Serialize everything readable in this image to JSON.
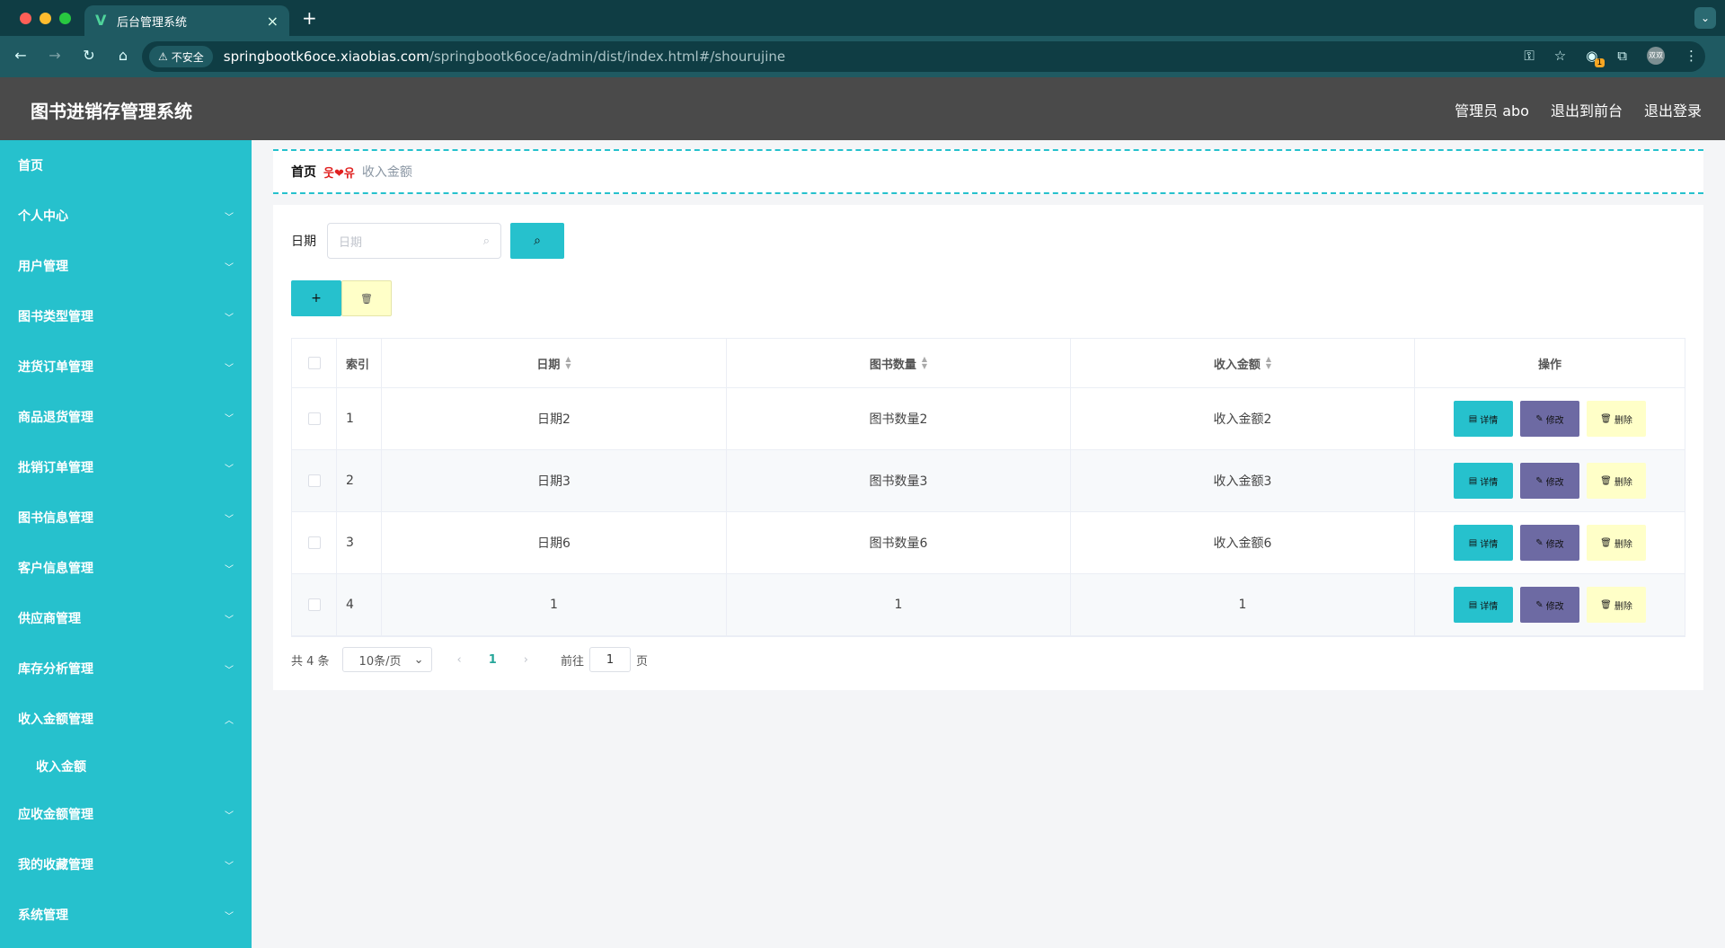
{
  "browser": {
    "tab_title": "后台管理系统",
    "insecure_label": "不安全",
    "url_host": "springbootk6oce.xiaobias.com",
    "url_path": "/springbootk6oce/admin/dist/index.html#/shourujine",
    "extension_badge": "1",
    "avatar_text": "双双"
  },
  "header": {
    "title": "图书进销存管理系统",
    "user": "管理员 abo",
    "to_front": "退出到前台",
    "logout": "退出登录"
  },
  "sidebar": {
    "items": [
      {
        "label": "首页"
      },
      {
        "label": "个人中心"
      },
      {
        "label": "用户管理"
      },
      {
        "label": "图书类型管理"
      },
      {
        "label": "进货订单管理"
      },
      {
        "label": "商品退货管理"
      },
      {
        "label": "批销订单管理"
      },
      {
        "label": "图书信息管理"
      },
      {
        "label": "客户信息管理"
      },
      {
        "label": "供应商管理"
      },
      {
        "label": "库存分析管理"
      },
      {
        "label": "收入金额管理"
      },
      {
        "label": "收入金额"
      },
      {
        "label": "应收金额管理"
      },
      {
        "label": "我的收藏管理"
      },
      {
        "label": "系统管理"
      }
    ]
  },
  "breadcrumb": {
    "home": "首页",
    "separator": "웃❤유",
    "current": "收入金额"
  },
  "search": {
    "label": "日期",
    "placeholder": "日期"
  },
  "table": {
    "headers": {
      "index": "索引",
      "date": "日期",
      "qty": "图书数量",
      "amount": "收入金额",
      "ops": "操作"
    },
    "rows": [
      {
        "index": "1",
        "date": "日期2",
        "qty": "图书数量2",
        "amount": "收入金额2"
      },
      {
        "index": "2",
        "date": "日期3",
        "qty": "图书数量3",
        "amount": "收入金额3"
      },
      {
        "index": "3",
        "date": "日期6",
        "qty": "图书数量6",
        "amount": "收入金额6"
      },
      {
        "index": "4",
        "date": "1",
        "qty": "1",
        "amount": "1"
      }
    ],
    "op_labels": {
      "detail": "详情",
      "edit": "修改",
      "delete": "删除"
    }
  },
  "pagination": {
    "total": "共 4 条",
    "page_size": "10条/页",
    "current_page": "1",
    "goto_prefix": "前往",
    "goto_value": "1",
    "goto_suffix": "页"
  },
  "colors": {
    "accent": "#26c1cd",
    "header_bg": "#4a4a4a",
    "edit_btn": "#6d6aa3",
    "delete_btn": "#ffffc8"
  }
}
